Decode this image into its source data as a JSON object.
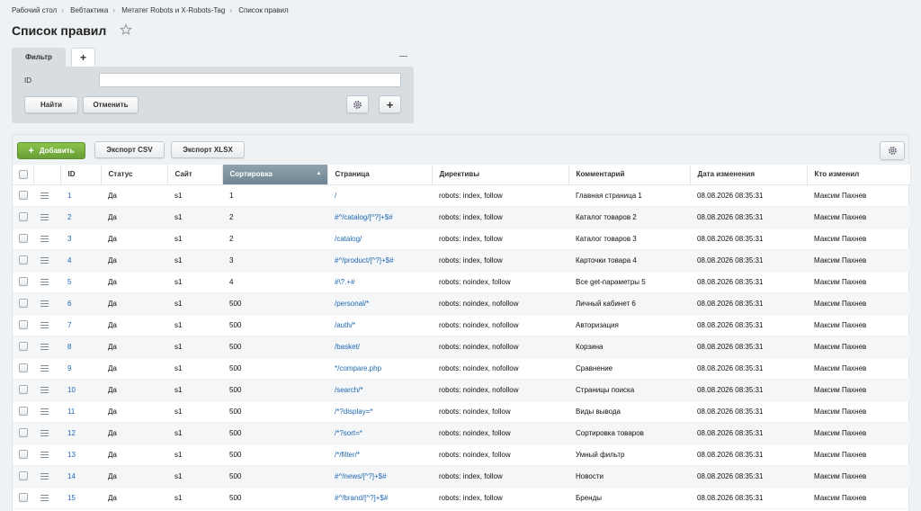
{
  "breadcrumb": [
    "Рабочий стол",
    "Вебтактика",
    "Метатег Robots и X-Robots-Tag",
    "Список правил"
  ],
  "page_title": "Список правил",
  "filter": {
    "tab_label": "Фильтр",
    "add_tab": "+",
    "field_label": "ID",
    "field_value": "",
    "find_label": "Найти",
    "cancel_label": "Отменить",
    "add_label": "+"
  },
  "toolbar": {
    "add_label": "Добавить",
    "csv_label": "Экспорт CSV",
    "xlsx_label": "Экспорт XLSX"
  },
  "columns": [
    "ID",
    "Статус",
    "Сайт",
    "Сортировка",
    "Страница",
    "Директивы",
    "Комментарий",
    "Дата изменения",
    "Кто изменил"
  ],
  "rows": [
    {
      "id": "1",
      "status": "Да",
      "site": "s1",
      "sort": "1",
      "page": "/",
      "directives": "robots: index, follow",
      "comment": "Главная страница 1",
      "date": "08.08.2026 08:35:31",
      "user": "Максим Пахнев"
    },
    {
      "id": "2",
      "status": "Да",
      "site": "s1",
      "sort": "2",
      "page": "#^/catalog/[^?]+$#",
      "directives": "robots: index, follow",
      "comment": "Каталог товаров 2",
      "date": "08.08.2026 08:35:31",
      "user": "Максим Пахнев"
    },
    {
      "id": "3",
      "status": "Да",
      "site": "s1",
      "sort": "2",
      "page": "/catalog/",
      "directives": "robots: index, follow",
      "comment": "Каталог товаров 3",
      "date": "08.08.2026 08:35:31",
      "user": "Максим Пахнев"
    },
    {
      "id": "4",
      "status": "Да",
      "site": "s1",
      "sort": "3",
      "page": "#^/product/[^?]+$#",
      "directives": "robots: index, follow",
      "comment": "Карточки товара 4",
      "date": "08.08.2026 08:35:31",
      "user": "Максим Пахнев"
    },
    {
      "id": "5",
      "status": "Да",
      "site": "s1",
      "sort": "4",
      "page": "#\\?.+#",
      "directives": "robots: noindex, follow",
      "comment": "Все get-параметры 5",
      "date": "08.08.2026 08:35:31",
      "user": "Максим Пахнев"
    },
    {
      "id": "6",
      "status": "Да",
      "site": "s1",
      "sort": "500",
      "page": "/personal/*",
      "directives": "robots: noindex, nofollow",
      "comment": "Личный кабинет 6",
      "date": "08.08.2026 08:35:31",
      "user": "Максим Пахнев"
    },
    {
      "id": "7",
      "status": "Да",
      "site": "s1",
      "sort": "500",
      "page": "/auth/*",
      "directives": "robots: noindex, nofollow",
      "comment": "Авторизация",
      "date": "08.08.2026 08:35:31",
      "user": "Максим Пахнев"
    },
    {
      "id": "8",
      "status": "Да",
      "site": "s1",
      "sort": "500",
      "page": "/basket/",
      "directives": "robots: noindex, nofollow",
      "comment": "Корзина",
      "date": "08.08.2026 08:35:31",
      "user": "Максим Пахнев"
    },
    {
      "id": "9",
      "status": "Да",
      "site": "s1",
      "sort": "500",
      "page": "*/compare.php",
      "directives": "robots: noindex, nofollow",
      "comment": "Сравнение",
      "date": "08.08.2026 08:35:31",
      "user": "Максим Пахнев"
    },
    {
      "id": "10",
      "status": "Да",
      "site": "s1",
      "sort": "500",
      "page": "/search/*",
      "directives": "robots: noindex, nofollow",
      "comment": "Страницы поиска",
      "date": "08.08.2026 08:35:31",
      "user": "Максим Пахнев"
    },
    {
      "id": "11",
      "status": "Да",
      "site": "s1",
      "sort": "500",
      "page": "/*?display=*",
      "directives": "robots: noindex, follow",
      "comment": "Виды вывода",
      "date": "08.08.2026 08:35:31",
      "user": "Максим Пахнев"
    },
    {
      "id": "12",
      "status": "Да",
      "site": "s1",
      "sort": "500",
      "page": "/*?sort=*",
      "directives": "robots: noindex, follow",
      "comment": "Сортировка товаров",
      "date": "08.08.2026 08:35:31",
      "user": "Максим Пахнев"
    },
    {
      "id": "13",
      "status": "Да",
      "site": "s1",
      "sort": "500",
      "page": "/*/filter/*",
      "directives": "robots: noindex, follow",
      "comment": "Умный фильтр",
      "date": "08.08.2026 08:35:31",
      "user": "Максим Пахнев"
    },
    {
      "id": "14",
      "status": "Да",
      "site": "s1",
      "sort": "500",
      "page": "#^/news/[^?]+$#",
      "directives": "robots: index, follow",
      "comment": "Новости",
      "date": "08.08.2026 08:35:31",
      "user": "Максим Пахнев"
    },
    {
      "id": "15",
      "status": "Да",
      "site": "s1",
      "sort": "500",
      "page": "#^/brand/[^?]+$#",
      "directives": "robots: index, follow",
      "comment": "Бренды",
      "date": "08.08.2026 08:35:31",
      "user": "Максим Пахнев"
    }
  ],
  "icons": {
    "favorite": "star-icon",
    "settings": "gear-icon",
    "row_menu": "hamburger-menu-icon",
    "sort": "sort-ascending-icon"
  },
  "colors": {
    "accent_green": "#7cb342",
    "link_blue": "#2067b0",
    "visited_purple": "#7f4aa0",
    "sorted_header": "#7b8f9b"
  }
}
